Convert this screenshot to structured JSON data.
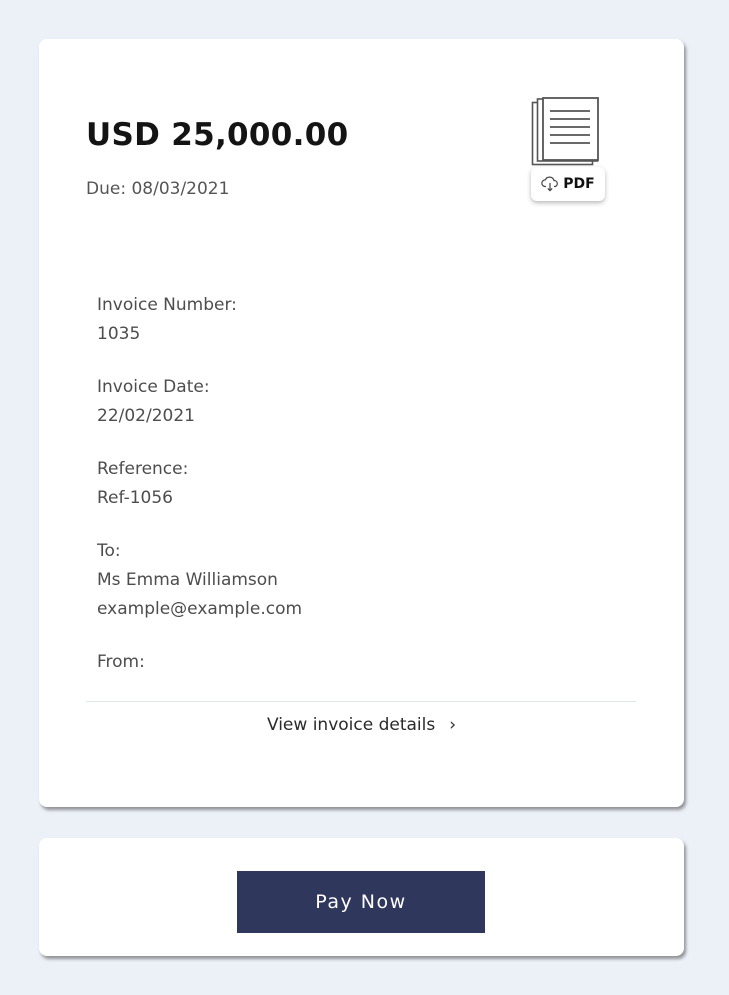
{
  "invoice": {
    "amount": "USD 25,000.00",
    "due": "Due: 08/03/2021",
    "pdf_label": "PDF",
    "fields": [
      {
        "label": "Invoice Number:",
        "values": [
          "1035"
        ]
      },
      {
        "label": "Invoice Date:",
        "values": [
          "22/02/2021"
        ]
      },
      {
        "label": "Reference:",
        "values": [
          "Ref-1056"
        ]
      },
      {
        "label": "To:",
        "values": [
          "Ms Emma Williamson",
          "example@example.com"
        ]
      },
      {
        "label": "From:",
        "values": []
      }
    ],
    "view_details": "View invoice details",
    "chevron_glyph": "›"
  },
  "payment": {
    "pay_label": "Pay Now",
    "button_color": "#30375c"
  },
  "icons": {
    "pdf": "document-icon",
    "download": "cloud-download-icon",
    "chevron": "chevron-right-icon"
  }
}
